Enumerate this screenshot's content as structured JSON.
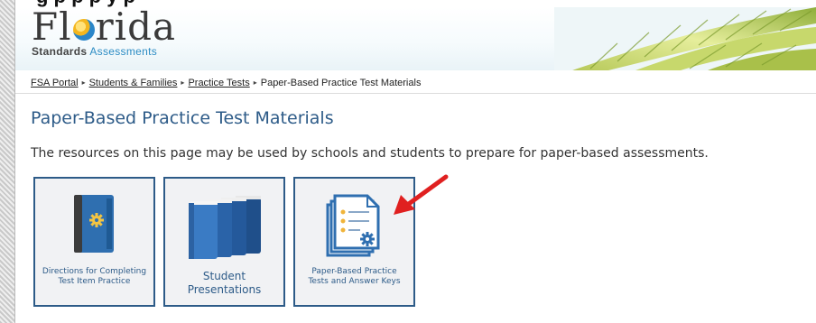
{
  "top_text": "g                                    p                    p p y                         p",
  "header": {
    "logo_word_before": "Fl",
    "logo_word_after": "rida",
    "logo_sub_bold": "Standards",
    "logo_sub_light": "Assessments",
    "colors": {
      "brand_blue": "#2d8cc4",
      "title_blue": "#2d5b88"
    }
  },
  "breadcrumb": {
    "items": [
      "FSA Portal",
      "Students & Families",
      "Practice Tests"
    ],
    "current": "Paper-Based Practice Test Materials",
    "separator": "▸"
  },
  "page": {
    "title": "Paper-Based Practice Test Materials",
    "intro": "The resources on this page may be used by schools and students to prepare for paper-based assessments."
  },
  "tiles": [
    {
      "line1": "Directions for Completing",
      "line2": "Test Item Practice",
      "icon": "book-gear-icon"
    },
    {
      "line1": "Student",
      "line2": "Presentations",
      "icon": "books-stack-icon"
    },
    {
      "line1": "Paper-Based Practice",
      "line2": "Tests and Answer Keys",
      "icon": "documents-gear-icon"
    }
  ],
  "annotation": {
    "icon": "red-arrow-icon",
    "color": "#e02020"
  }
}
